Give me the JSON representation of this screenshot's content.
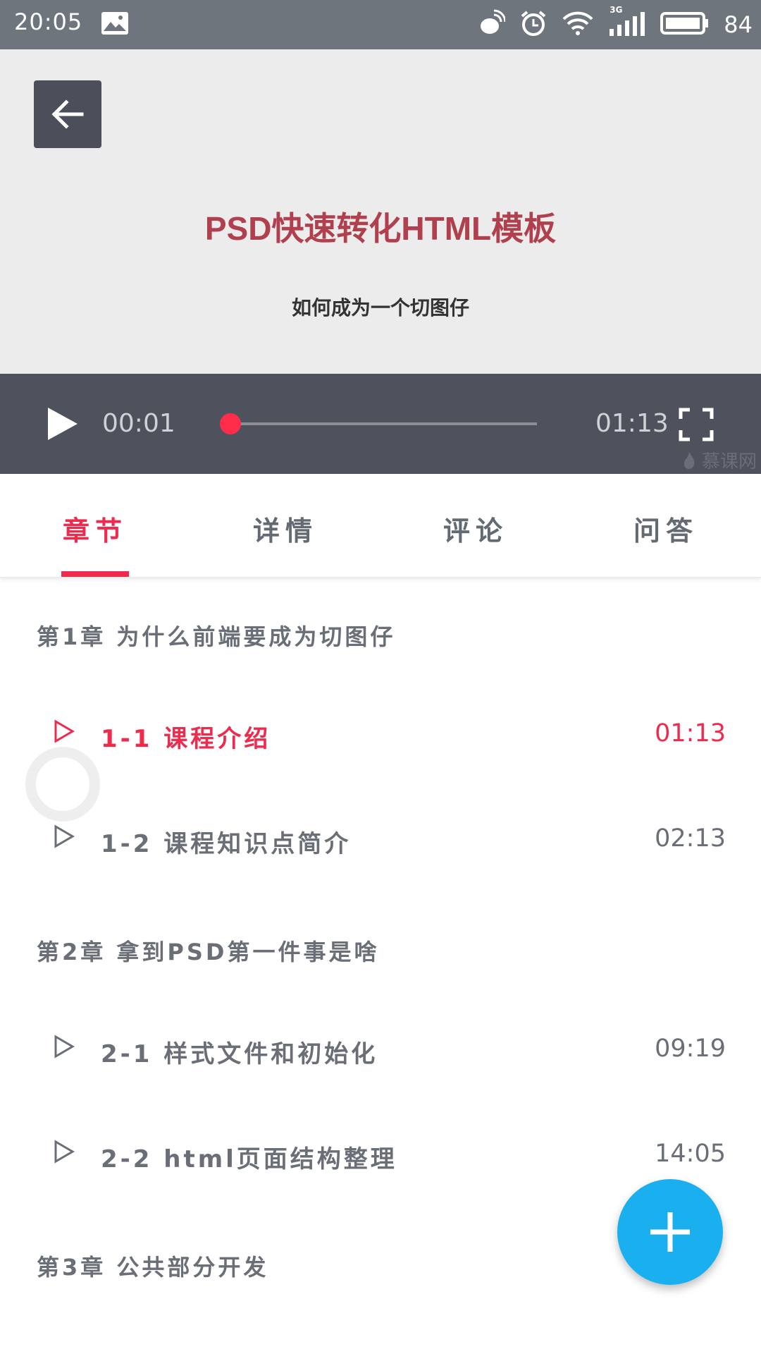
{
  "status_bar": {
    "time": "20:05",
    "battery": "84",
    "network": "3G",
    "icons": [
      "image-icon",
      "satellite-icon",
      "alarm-icon",
      "wifi-icon",
      "signal-icon",
      "battery-icon"
    ]
  },
  "video": {
    "title": "PSD快速转化HTML模板",
    "subtitle": "如何成为一个切图仔",
    "current_time": "00:01",
    "total_time": "01:13",
    "progress": 0.014,
    "watermark": "慕课网"
  },
  "tabs": [
    {
      "label": "章节",
      "active": true
    },
    {
      "label": "详情",
      "active": false
    },
    {
      "label": "评论",
      "active": false
    },
    {
      "label": "问答",
      "active": false
    }
  ],
  "chapters": [
    {
      "title": "第1章 为什么前端要成为切图仔",
      "lessons": [
        {
          "name": "1-1 课程介绍",
          "duration": "01:13",
          "current": true
        },
        {
          "name": "1-2 课程知识点简介",
          "duration": "02:13",
          "current": false
        }
      ]
    },
    {
      "title": "第2章 拿到PSD第一件事是啥",
      "lessons": [
        {
          "name": "2-1 样式文件和初始化",
          "duration": "09:19",
          "current": false
        },
        {
          "name": "2-2 html页面结构整理",
          "duration": "14:05",
          "current": false
        }
      ]
    },
    {
      "title": "第3章 公共部分开发",
      "lessons": []
    }
  ],
  "colors": {
    "accent": "#ee2b4d",
    "fab": "#1ab0f0",
    "controls_bg": "#4d525d",
    "status_bg": "#6e757c"
  }
}
